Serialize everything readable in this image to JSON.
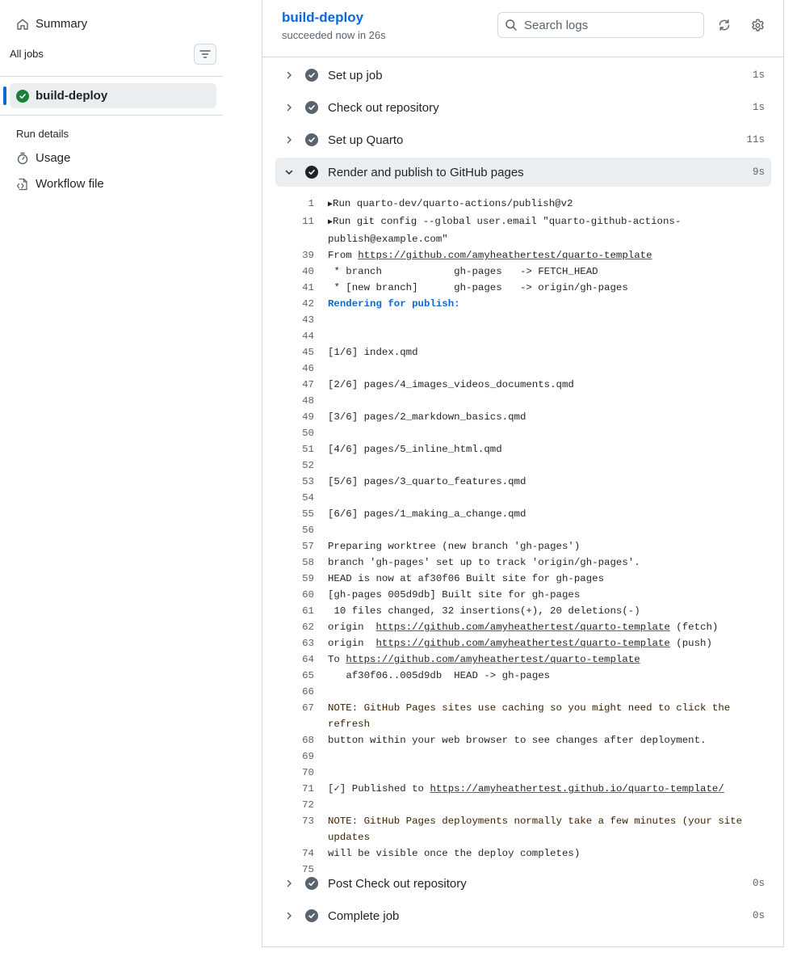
{
  "sidebar": {
    "summary_label": "Summary",
    "all_jobs_label": "All jobs",
    "active_job": "build-deploy",
    "run_details_label": "Run details",
    "usage_label": "Usage",
    "workflow_file_label": "Workflow file"
  },
  "header": {
    "title": "build-deploy",
    "subtitle": "succeeded now in 26s",
    "search_placeholder": "Search logs"
  },
  "steps": [
    {
      "name": "Set up job",
      "duration": "1s"
    },
    {
      "name": "Check out repository",
      "duration": "1s"
    },
    {
      "name": "Set up Quarto",
      "duration": "11s"
    },
    {
      "name": "Render and publish to GitHub pages",
      "duration": "9s"
    },
    {
      "name": "Post Check out repository",
      "duration": "0s"
    },
    {
      "name": "Complete job",
      "duration": "0s"
    }
  ],
  "log_lines": [
    {
      "n": "1",
      "text": "Run quarto-dev/quarto-actions/publish@v2",
      "group": true
    },
    {
      "n": "11",
      "text": "Run git config --global user.email \"quarto-github-actions-publish@example.com\"",
      "group": true
    },
    {
      "n": "39",
      "pre": "From ",
      "link": "https://github.com/amyheathertest/quarto-template"
    },
    {
      "n": "40",
      "text": " * branch            gh-pages   -> FETCH_HEAD"
    },
    {
      "n": "41",
      "text": " * [new branch]      gh-pages   -> origin/gh-pages"
    },
    {
      "n": "42",
      "text": "Rendering for publish:",
      "style": "blue"
    },
    {
      "n": "43",
      "text": ""
    },
    {
      "n": "44",
      "text": ""
    },
    {
      "n": "45",
      "text": "[1/6] index.qmd"
    },
    {
      "n": "46",
      "text": ""
    },
    {
      "n": "47",
      "text": "[2/6] pages/4_images_videos_documents.qmd"
    },
    {
      "n": "48",
      "text": ""
    },
    {
      "n": "49",
      "text": "[3/6] pages/2_markdown_basics.qmd"
    },
    {
      "n": "50",
      "text": ""
    },
    {
      "n": "51",
      "text": "[4/6] pages/5_inline_html.qmd"
    },
    {
      "n": "52",
      "text": ""
    },
    {
      "n": "53",
      "text": "[5/6] pages/3_quarto_features.qmd"
    },
    {
      "n": "54",
      "text": ""
    },
    {
      "n": "55",
      "text": "[6/6] pages/1_making_a_change.qmd"
    },
    {
      "n": "56",
      "text": ""
    },
    {
      "n": "57",
      "text": "Preparing worktree (new branch 'gh-pages')"
    },
    {
      "n": "58",
      "text": "branch 'gh-pages' set up to track 'origin/gh-pages'."
    },
    {
      "n": "59",
      "text": "HEAD is now at af30f06 Built site for gh-pages"
    },
    {
      "n": "60",
      "text": "[gh-pages 005d9db] Built site for gh-pages"
    },
    {
      "n": "61",
      "text": " 10 files changed, 32 insertions(+), 20 deletions(-)"
    },
    {
      "n": "62",
      "pre": "origin  ",
      "link": "https://github.com/amyheathertest/quarto-template",
      "post": " (fetch)"
    },
    {
      "n": "63",
      "pre": "origin  ",
      "link": "https://github.com/amyheathertest/quarto-template",
      "post": " (push)"
    },
    {
      "n": "64",
      "pre": "To ",
      "link": "https://github.com/amyheathertest/quarto-template"
    },
    {
      "n": "65",
      "text": "   af30f06..005d9db  HEAD -> gh-pages"
    },
    {
      "n": "66",
      "text": ""
    },
    {
      "n": "67",
      "text": "NOTE: GitHub Pages sites use caching so you might need to click the refresh",
      "style": "note"
    },
    {
      "n": "68",
      "text": "button within your web browser to see changes after deployment."
    },
    {
      "n": "69",
      "text": ""
    },
    {
      "n": "70",
      "text": ""
    },
    {
      "n": "71",
      "pre": "[✓] Published to ",
      "link": "https://amyheathertest.github.io/quarto-template/"
    },
    {
      "n": "72",
      "text": ""
    },
    {
      "n": "73",
      "text": "NOTE: GitHub Pages deployments normally take a few minutes (your site updates",
      "style": "note"
    },
    {
      "n": "74",
      "text": "will be visible once the deploy completes)"
    },
    {
      "n": "75",
      "text": ""
    }
  ],
  "colors": {
    "accent": "#0969da",
    "success": "#1a7f37",
    "muted": "#59636e",
    "border": "#d0d7de"
  },
  "icons": {
    "summary": "home-icon",
    "filter": "filter-icon",
    "usage": "stopwatch-icon",
    "workflow": "file-code-icon",
    "search": "search-icon",
    "refresh": "sync-icon",
    "settings": "gear-icon",
    "step_status": "check-circle-icon",
    "expand": "chevron-right-icon",
    "collapse": "chevron-down-icon"
  }
}
